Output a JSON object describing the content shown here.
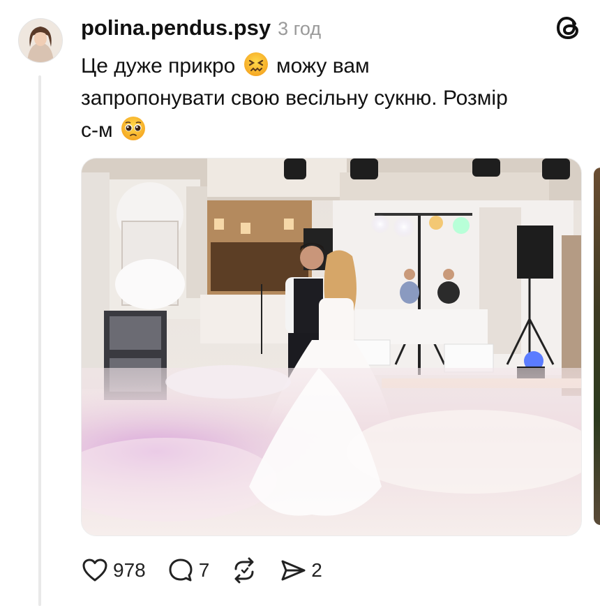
{
  "post": {
    "author": "polina.pendus.psy",
    "time": "3 год",
    "text_line1_a": "Це дуже прикро",
    "text_line1_b": "можу вам",
    "text_line2": "запропонувати свою весільну сукню. Розмір",
    "text_line3": "с-м",
    "emoji_1": "persevering-face-emoji",
    "emoji_2": "pleading-face-emoji",
    "media_description_icon": "wedding-photo",
    "app_logo": "threads-logo-icon"
  },
  "actions": {
    "likes": "978",
    "replies": "7",
    "shares": "2",
    "like_icon": "heart-icon",
    "reply_icon": "comment-bubble-icon",
    "repost_icon": "repost-icon",
    "share_icon": "send-icon"
  },
  "colors": {
    "text": "#111111",
    "muted": "#9a9a9a",
    "thread_line": "#e9e9e9"
  }
}
